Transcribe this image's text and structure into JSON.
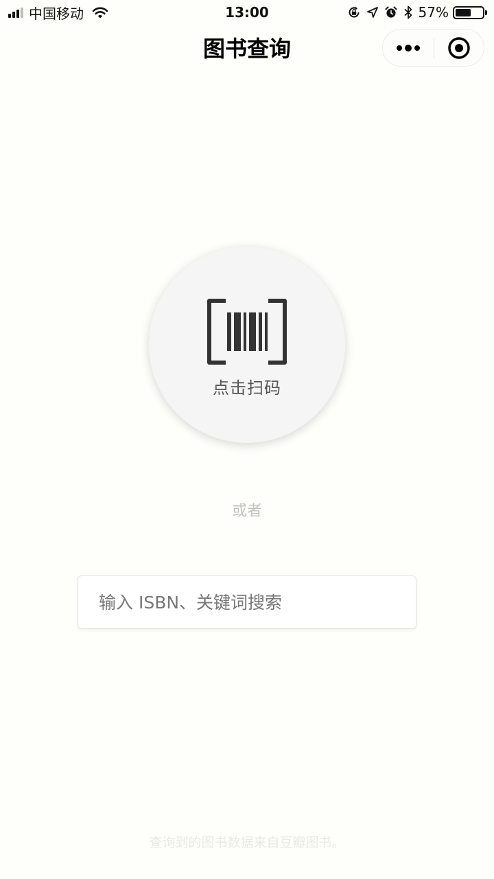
{
  "status_bar": {
    "carrier": "中国移动",
    "time": "13:00",
    "battery_percent": "57%",
    "battery_level": 0.57,
    "icons": [
      "signal-icon",
      "wifi-icon",
      "rotation-lock-icon",
      "location-icon",
      "alarm-icon",
      "bluetooth-icon",
      "battery-icon"
    ]
  },
  "nav": {
    "title": "图书查询",
    "capsule_icons": [
      "more-icon",
      "close-target-icon"
    ]
  },
  "scan": {
    "label": "点击扫码",
    "icon": "barcode-scan-icon"
  },
  "divider_text": "或者",
  "search": {
    "placeholder": "输入 ISBN、关键词搜索",
    "value": ""
  },
  "footer": {
    "note": "查询到的图书数据来自豆瓣图书。"
  },
  "colors": {
    "background": "#fefefb",
    "scan_circle": "#f5f5f5",
    "icon_dark": "#333333"
  }
}
